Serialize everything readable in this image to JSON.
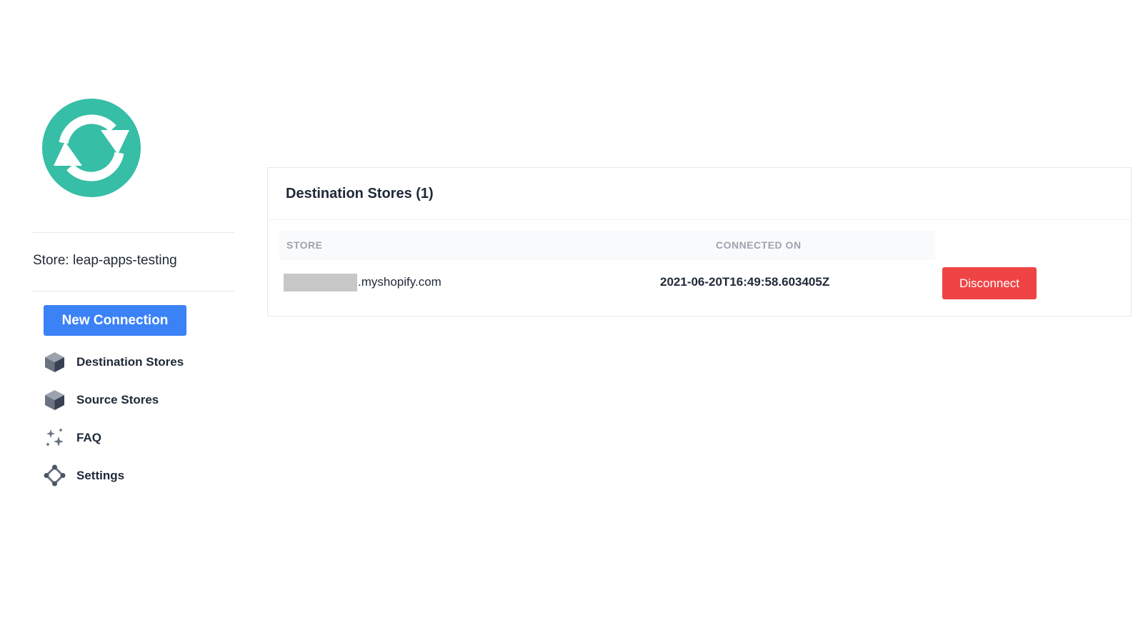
{
  "sidebar": {
    "logo_icon": "sync-arrows-icon",
    "logo_color": "#36bea6",
    "store_label": "Store: leap-apps-testing",
    "new_connection_label": "New Connection",
    "nav_items": [
      {
        "label": "Destination Stores",
        "icon": "box-icon"
      },
      {
        "label": "Source Stores",
        "icon": "box-icon"
      },
      {
        "label": "FAQ",
        "icon": "sparkles-icon"
      },
      {
        "label": "Settings",
        "icon": "diamond-nodes-icon"
      }
    ]
  },
  "main": {
    "card_title": "Destination Stores (1)",
    "table": {
      "headers": [
        "STORE",
        "CONNECTED ON"
      ],
      "rows": [
        {
          "store_suffix": ".myshopify.com",
          "connected_on": "2021-06-20T16:49:58.603405Z",
          "action_label": "Disconnect"
        }
      ]
    }
  },
  "colors": {
    "primary": "#3b82f6",
    "danger": "#ef4444",
    "brand": "#36bea6"
  }
}
